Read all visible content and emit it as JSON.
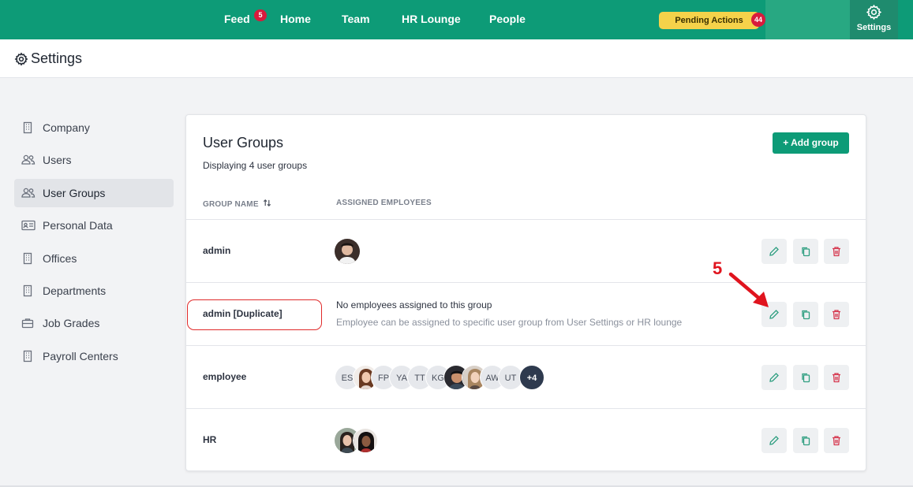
{
  "nav": {
    "feed": "Feed",
    "feed_badge": "5",
    "home": "Home",
    "team": "Team",
    "hr_lounge": "HR Lounge",
    "people": "People",
    "pending": "Pending Actions",
    "pending_badge": "44",
    "settings": "Settings"
  },
  "page": {
    "title": "Settings"
  },
  "sidebar": {
    "items": [
      {
        "label": "Company",
        "icon": "building-icon"
      },
      {
        "label": "Users",
        "icon": "users-icon"
      },
      {
        "label": "User Groups",
        "icon": "users-icon"
      },
      {
        "label": "Personal Data",
        "icon": "id-card-icon"
      },
      {
        "label": "Offices",
        "icon": "building-icon"
      },
      {
        "label": "Departments",
        "icon": "building-icon"
      },
      {
        "label": "Job Grades",
        "icon": "briefcase-icon"
      },
      {
        "label": "Payroll Centers",
        "icon": "building-icon"
      }
    ],
    "active": "User Groups"
  },
  "card": {
    "title": "User Groups",
    "subtitle": "Displaying 4 user groups",
    "add_button": "+ Add group",
    "col_group": "GROUP NAME",
    "col_employees": "ASSIGNED EMPLOYEES"
  },
  "rows": [
    {
      "name": "admin"
    },
    {
      "name": "admin [Duplicate]",
      "empty_title": "No employees assigned to this group",
      "empty_hint": "Employee can be assigned to specific user group from User Settings or HR lounge"
    },
    {
      "name": "employee",
      "initials": [
        "ES",
        "FP",
        "YA",
        "TT",
        "KG",
        "AW",
        "UT"
      ],
      "more": "+4"
    },
    {
      "name": "HR"
    }
  ],
  "annotation": {
    "step": "5"
  },
  "colors": {
    "brand": "#0d9b77",
    "danger": "#d81b3c",
    "pending": "#f5d24a"
  }
}
